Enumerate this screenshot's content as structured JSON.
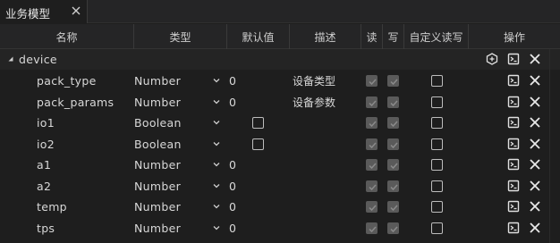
{
  "tab": {
    "label": "业务模型"
  },
  "columns": {
    "name": "名称",
    "type": "类型",
    "default": "默认值",
    "desc": "描述",
    "read": "读",
    "write": "写",
    "custom_rw": "自定义读写",
    "actions": "操作"
  },
  "group": {
    "label": "device"
  },
  "rows": [
    {
      "name": "pack_type",
      "type": "Number",
      "default": "0",
      "desc": "设备类型",
      "default_kind": "value"
    },
    {
      "name": "pack_params",
      "type": "Number",
      "default": "0",
      "desc": "设备参数",
      "default_kind": "value"
    },
    {
      "name": "io1",
      "type": "Boolean",
      "default": "",
      "desc": "",
      "default_kind": "checkbox"
    },
    {
      "name": "io2",
      "type": "Boolean",
      "default": "",
      "desc": "",
      "default_kind": "checkbox"
    },
    {
      "name": "a1",
      "type": "Number",
      "default": "0",
      "desc": "",
      "default_kind": "value"
    },
    {
      "name": "a2",
      "type": "Number",
      "default": "0",
      "desc": "",
      "default_kind": "value"
    },
    {
      "name": "temp",
      "type": "Number",
      "default": "0",
      "desc": "",
      "default_kind": "value"
    },
    {
      "name": "tps",
      "type": "Number",
      "default": "0",
      "desc": "",
      "default_kind": "value"
    }
  ],
  "icons": {
    "tab_close": "close-icon",
    "group_add": "add-node-icon",
    "row_edit": "script-edit-icon",
    "row_delete": "close-icon",
    "type_dropdown": "chevron-down-icon",
    "expand": "triangle-expand-icon"
  },
  "colors": {
    "background": "#1e1e1e",
    "header": "#252526",
    "text": "#d4d4d4",
    "checkbox_disabled": "#5a5a5a"
  }
}
